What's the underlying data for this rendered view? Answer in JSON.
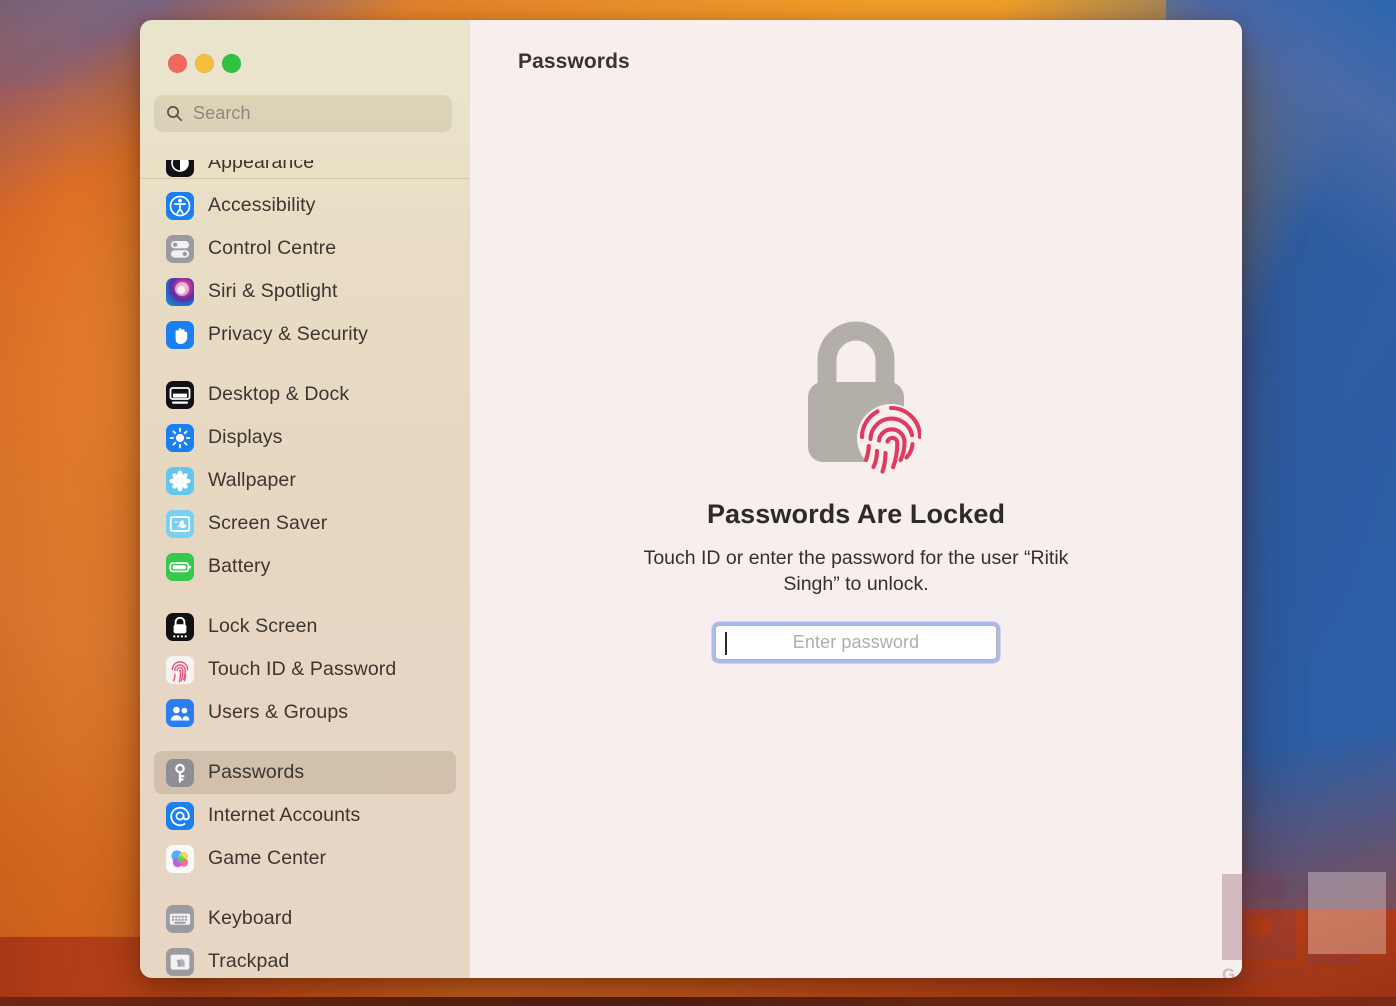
{
  "window": {
    "traffic_lights": [
      {
        "name": "close",
        "color": "#ef6a5c"
      },
      {
        "name": "minimize",
        "color": "#f3bd3e"
      },
      {
        "name": "zoom",
        "color": "#2fc23f"
      }
    ]
  },
  "search": {
    "placeholder": "Search",
    "value": "",
    "icon": "search-icon"
  },
  "sidebar": {
    "items": [
      {
        "label": "Appearance",
        "icon": "appearance-icon",
        "theme": "ic-appearance",
        "selected": false,
        "clipped_top": true
      },
      {
        "label": "Accessibility",
        "icon": "accessibility-icon",
        "theme": "ic-access",
        "selected": false
      },
      {
        "label": "Control Centre",
        "icon": "control-centre-icon",
        "theme": "ic-control",
        "selected": false
      },
      {
        "label": "Siri & Spotlight",
        "icon": "siri-icon",
        "theme": "ic-siri",
        "selected": false
      },
      {
        "label": "Privacy & Security",
        "icon": "privacy-hand-icon",
        "theme": "ic-privacy",
        "selected": false
      },
      {
        "label": "Desktop & Dock",
        "icon": "desktop-dock-icon",
        "theme": "ic-desktop",
        "selected": false,
        "group_start": true
      },
      {
        "label": "Displays",
        "icon": "displays-sun-icon",
        "theme": "ic-displays",
        "selected": false
      },
      {
        "label": "Wallpaper",
        "icon": "wallpaper-icon",
        "theme": "ic-wallpaper",
        "selected": false
      },
      {
        "label": "Screen Saver",
        "icon": "screen-saver-icon",
        "theme": "ic-saver",
        "selected": false
      },
      {
        "label": "Battery",
        "icon": "battery-icon",
        "theme": "ic-battery",
        "selected": false
      },
      {
        "label": "Lock Screen",
        "icon": "lock-screen-icon",
        "theme": "ic-lock",
        "selected": false,
        "group_start": true
      },
      {
        "label": "Touch ID & Password",
        "icon": "fingerprint-icon",
        "theme": "ic-touchid",
        "selected": false
      },
      {
        "label": "Users & Groups",
        "icon": "users-groups-icon",
        "theme": "ic-users",
        "selected": false
      },
      {
        "label": "Passwords",
        "icon": "key-icon",
        "theme": "ic-passwords",
        "selected": true,
        "group_start": true
      },
      {
        "label": "Internet Accounts",
        "icon": "at-sign-icon",
        "theme": "ic-internet",
        "selected": false
      },
      {
        "label": "Game Center",
        "icon": "game-center-icon",
        "theme": "ic-gamecenter",
        "selected": false
      },
      {
        "label": "Keyboard",
        "icon": "keyboard-icon",
        "theme": "ic-keyboard",
        "selected": false,
        "group_start": true
      },
      {
        "label": "Trackpad",
        "icon": "trackpad-icon",
        "theme": "ic-trackpad",
        "selected": false,
        "clipped_bottom": true
      }
    ]
  },
  "main": {
    "title": "Passwords",
    "lock_icon": "lock-fingerprint-icon",
    "heading": "Passwords Are Locked",
    "subtitle": "Touch ID or enter the password for the user “Ritik Singh” to unlock.",
    "password_input": {
      "placeholder": "Enter password",
      "value": "",
      "focused": true
    }
  },
  "watermark": {
    "text": "GADGETS"
  },
  "colors": {
    "sidebar_top": "#e9e5cd",
    "sidebar_bottom": "#e8d6c5",
    "content_bg": "#f7efed",
    "selection": "rgba(160,142,118,0.30)",
    "accent_focus": "#6a8ceb",
    "fingerprint": "#e03a5f",
    "lock_body": "#b3aea8"
  }
}
